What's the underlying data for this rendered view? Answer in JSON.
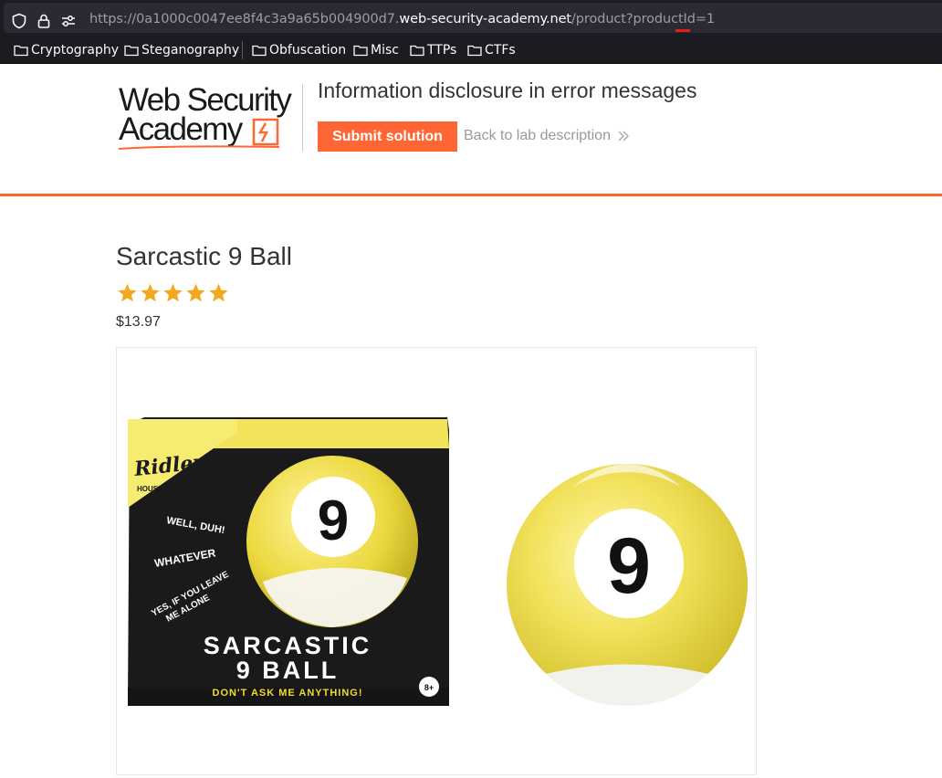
{
  "browser": {
    "url_prefix": "https://0a1000c0047ee8f4c3a9a65b004900d7.",
    "url_domain": "web-security-academy.net",
    "url_path": "/product?productId=",
    "url_param_value": "1",
    "icons": [
      "shield-icon",
      "lock-icon",
      "page-settings-icon",
      "folder-icon"
    ]
  },
  "bookmarks": [
    {
      "label": "Cryptography"
    },
    {
      "label": "Steganography"
    },
    {
      "label": "Obfuscation"
    },
    {
      "label": "Misc"
    },
    {
      "label": "TTPs"
    },
    {
      "label": "CTFs"
    }
  ],
  "lab_header": {
    "logo_line1": "Web Security",
    "logo_line2": "Academy",
    "title": "Information disclosure in error messages",
    "submit_label": "Submit solution",
    "back_label": "Back to lab description",
    "accent_color": "#ff6633"
  },
  "product": {
    "title": "Sarcastic 9 Ball",
    "rating": 5,
    "rating_max": 5,
    "price": "$13.97",
    "image": {
      "brand": "Ridley's",
      "brand_sub": "HOUSE of NOVELTIES",
      "ball_number": "9",
      "box_phrases": [
        "WELL, DUH!",
        "WHATEVER",
        "YES, IF YOU LEAVE",
        "ME ALONE"
      ],
      "box_title_1": "SARCASTIC",
      "box_title_2": "9 BALL",
      "box_tagline": "DON'T ASK ME ANYTHING!",
      "age_badge": "8+"
    }
  }
}
